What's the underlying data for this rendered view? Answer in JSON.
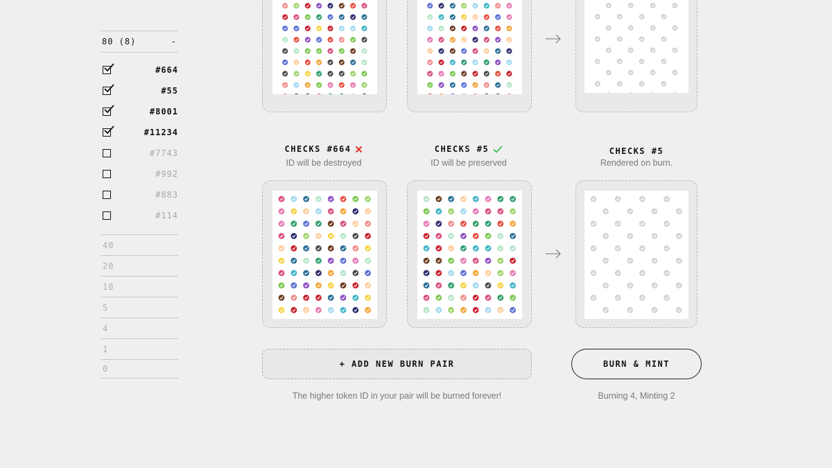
{
  "sidebar": {
    "group_label": "80 (8)",
    "group_toggle": "-",
    "tokens": [
      {
        "id": "#664",
        "checked": true
      },
      {
        "id": "#55",
        "checked": true
      },
      {
        "id": "#8001",
        "checked": true
      },
      {
        "id": "#11234",
        "checked": true
      },
      {
        "id": "#7743",
        "checked": false
      },
      {
        "id": "#992",
        "checked": false
      },
      {
        "id": "#883",
        "checked": false
      },
      {
        "id": "#114",
        "checked": false
      }
    ],
    "filters": [
      "40",
      "20",
      "10",
      "5",
      "4",
      "1",
      "0"
    ]
  },
  "pairs": [
    {
      "burn": {
        "title": "",
        "subtitle": ""
      },
      "keep": {
        "title": "",
        "subtitle": ""
      },
      "result": {
        "title": "",
        "subtitle": ""
      }
    },
    {
      "burn": {
        "title": "CHECKS #664",
        "subtitle": "ID will be destroyed",
        "status_icon": "x-icon",
        "status_color": "#e0312b"
      },
      "keep": {
        "title": "CHECKS #5",
        "subtitle": "ID will be preserved",
        "status_icon": "check-icon",
        "status_color": "#3fbf55"
      },
      "result": {
        "title": "CHECKS #5",
        "subtitle": "Rendered on burn."
      }
    }
  ],
  "actions": {
    "add_pair_label": "+ ADD NEW BURN PAIR",
    "burn_mint_label": "BURN & MINT",
    "add_pair_note": "The higher token ID in your pair will be burned forever!",
    "burn_mint_note": "Burning 4, Minting 2"
  },
  "icons": {
    "arrow": "arrow-right-icon",
    "check": "check-icon",
    "close": "x-icon"
  },
  "colors": {
    "background": "#efefef",
    "frame": "#e9e9e9",
    "muted_check": "#d4d4d4",
    "palette": [
      "#e84c3d",
      "#f4a535",
      "#f7d348",
      "#7ac74f",
      "#2f9e6b",
      "#40b4c8",
      "#5b6fd6",
      "#8e4fc4",
      "#e87bb4",
      "#f28c8c",
      "#a3d9f0",
      "#b5e6c7",
      "#2c2c6c",
      "#6b3a1e",
      "#c8202e",
      "#ffcf9e",
      "#2a6f97",
      "#d94f7a",
      "#4a4a4a",
      "#9ed36a"
    ]
  }
}
